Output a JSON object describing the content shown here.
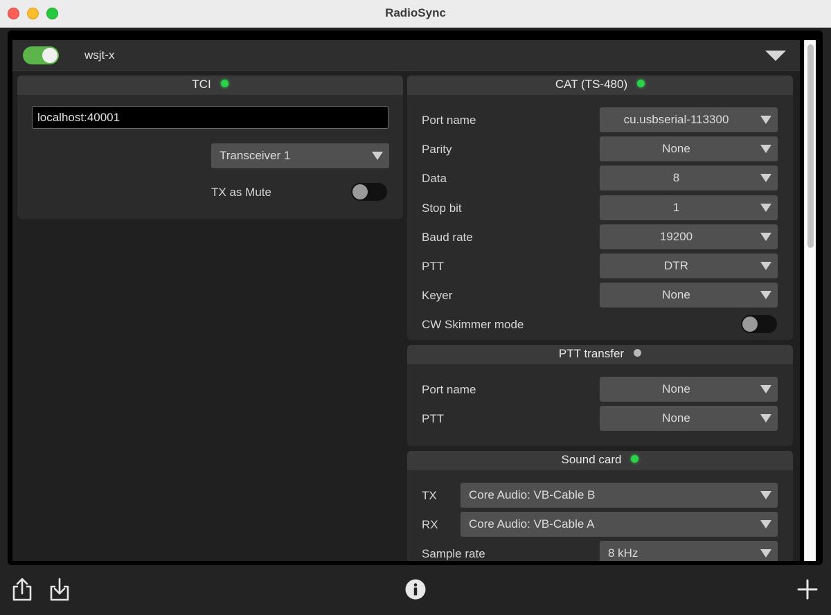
{
  "window": {
    "title": "RadioSync"
  },
  "profile": {
    "name": "wsjt-x",
    "enabled": true
  },
  "tci": {
    "title": "TCI",
    "status_color": "#2cd24a",
    "address": "localhost:40001",
    "transceiver": "Transceiver 1",
    "tx_mute_label": "TX as Mute",
    "tx_mute_on": false
  },
  "cat": {
    "title": "CAT (TS-480)",
    "status_color": "#2cd24a",
    "rows": [
      {
        "label": "Port name",
        "value": "cu.usbserial-113300"
      },
      {
        "label": "Parity",
        "value": "None"
      },
      {
        "label": "Data",
        "value": "8"
      },
      {
        "label": "Stop bit",
        "value": "1"
      },
      {
        "label": "Baud rate",
        "value": "19200"
      },
      {
        "label": "PTT",
        "value": "DTR"
      },
      {
        "label": "Keyer",
        "value": "None"
      }
    ],
    "skimmer_label": "CW Skimmer mode",
    "skimmer_on": false
  },
  "ptt_transfer": {
    "title": "PTT transfer",
    "status_color": "#b8b8b8",
    "rows": [
      {
        "label": "Port name",
        "value": "None"
      },
      {
        "label": "PTT",
        "value": "None"
      }
    ]
  },
  "sound_card": {
    "title": "Sound card",
    "status_color": "#2cd24a",
    "tx_label": "TX",
    "tx_value": "Core Audio: VB-Cable B",
    "rx_label": "RX",
    "rx_value": "Core Audio: VB-Cable A",
    "sample_rate_label": "Sample rate",
    "sample_rate_value": "8 kHz"
  },
  "footer": {
    "icons": [
      "share-icon",
      "download-icon",
      "info-icon",
      "plus-icon"
    ]
  }
}
